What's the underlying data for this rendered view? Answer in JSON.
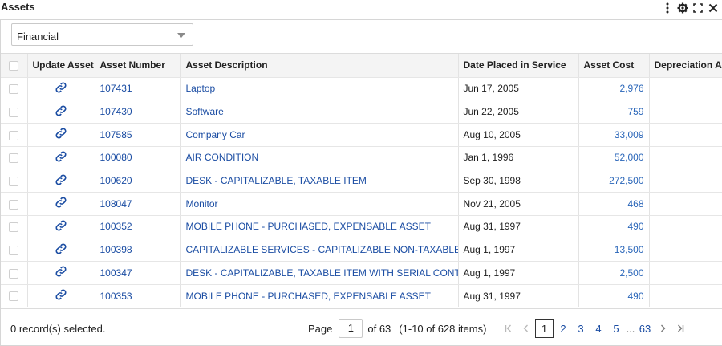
{
  "panel": {
    "title": "Assets",
    "tools": [
      "more-vertical-icon",
      "gear-icon",
      "expand-icon",
      "close-icon"
    ]
  },
  "filter": {
    "selected": "Financial"
  },
  "table": {
    "headers": {
      "select": "",
      "update": "Update Asset",
      "number": "Asset Number",
      "description": "Asset Description",
      "date": "Date Placed in Service",
      "cost": "Asset Cost",
      "depreciation": "Depreciation An"
    },
    "rows": [
      {
        "number": "107431",
        "description": "Laptop",
        "date": "Jun 17, 2005",
        "cost": "2,976",
        "depreciation": ""
      },
      {
        "number": "107430",
        "description": "Software",
        "date": "Jun 22, 2005",
        "cost": "759",
        "depreciation": ""
      },
      {
        "number": "107585",
        "description": "Company Car",
        "date": "Aug 10, 2005",
        "cost": "33,009",
        "depreciation": ""
      },
      {
        "number": "100080",
        "description": "AIR CONDITION",
        "date": "Jan 1, 1996",
        "cost": "52,000",
        "depreciation": ""
      },
      {
        "number": "100620",
        "description": "DESK - CAPITALIZABLE, TAXABLE ITEM",
        "date": "Sep 30, 1998",
        "cost": "272,500",
        "depreciation": ""
      },
      {
        "number": "108047",
        "description": "Monitor",
        "date": "Nov 21, 2005",
        "cost": "468",
        "depreciation": ""
      },
      {
        "number": "100352",
        "description": "MOBILE PHONE - PURCHASED, EXPENSABLE ASSET",
        "date": "Aug 31, 1997",
        "cost": "490",
        "depreciation": ""
      },
      {
        "number": "100398",
        "description": "CAPITALIZABLE SERVICES - CAPITALIZABLE NON-TAXABLE ITEM",
        "date": "Aug 1, 1997",
        "cost": "13,500",
        "depreciation": ""
      },
      {
        "number": "100347",
        "description": "DESK - CAPITALIZABLE, TAXABLE ITEM WITH SERIAL CONTROL",
        "date": "Aug 1, 1997",
        "cost": "2,500",
        "depreciation": ""
      },
      {
        "number": "100353",
        "description": "MOBILE PHONE - PURCHASED, EXPENSABLE ASSET",
        "date": "Aug 31, 1997",
        "cost": "490",
        "depreciation": ""
      }
    ]
  },
  "footer": {
    "selection": "0 record(s) selected.",
    "page_label": "Page",
    "page_value": "1",
    "of_pages": "of 63",
    "range": "(1-10 of 628 items)",
    "pages": [
      "1",
      "2",
      "3",
      "4",
      "5"
    ],
    "ellipsis": "...",
    "last_page": "63"
  },
  "colors": {
    "link": "#1b4da3",
    "cost": "#2a66b9",
    "header_bg": "#f4f4f4"
  }
}
